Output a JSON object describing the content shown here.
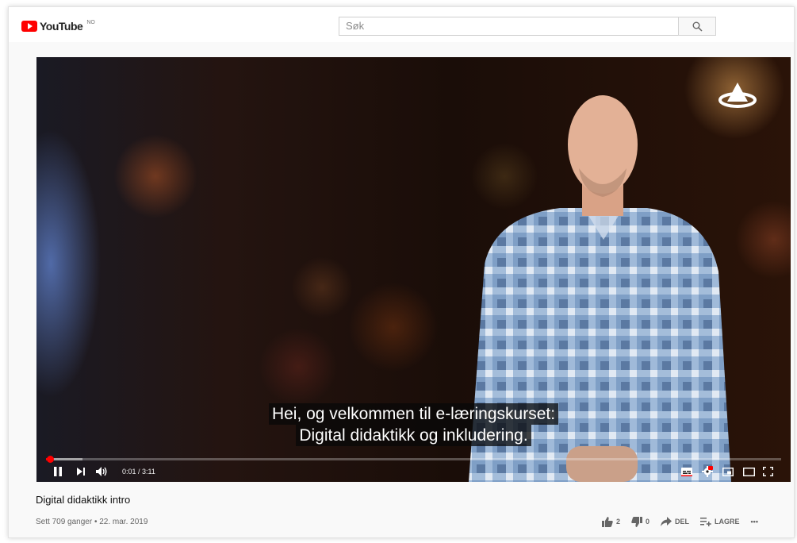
{
  "header": {
    "logo_text": "YouTube",
    "logo_sup": "NO",
    "search_placeholder": "Søk"
  },
  "player": {
    "subtitle_line1": "Hei, og velkommen til e-læringskurset:",
    "subtitle_line2": "Digital didaktikk og inkludering.",
    "time_display": "0:01 / 3:11",
    "progress_fraction": 0.005,
    "buffered_fraction": 0.05
  },
  "video": {
    "title": "Digital didaktikk intro",
    "meta": "Sett 709 ganger • 22. mar. 2019"
  },
  "actions": {
    "likes": "2",
    "dislikes": "0",
    "share_label": "DEL",
    "save_label": "LAGRE",
    "more_label": "•••"
  },
  "colors": {
    "accent": "#ff0000",
    "page_bg": "#f9f9f9"
  }
}
